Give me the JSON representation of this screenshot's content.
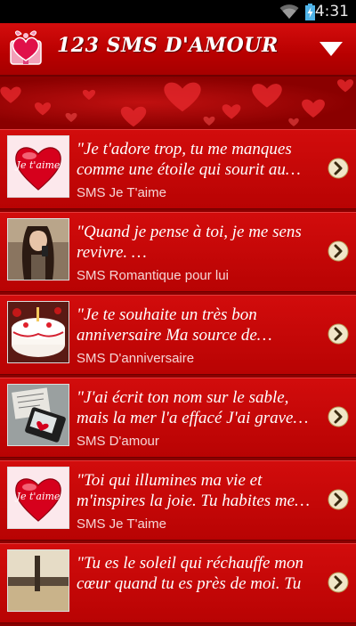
{
  "status_bar": {
    "time": "4:31",
    "icons": [
      "wifi-icon",
      "battery-charging-icon"
    ]
  },
  "app": {
    "title": "123 SMS D'AMOUR",
    "logo_icon": "heart-gift-box-icon",
    "menu_icon": "triangle-down-icon",
    "accent_color": "#c80000"
  },
  "items": [
    {
      "line1": "\"Je t'adore trop, tu me manques",
      "line2": "comme une étoile qui sourit au…",
      "category": "SMS Je T'aime",
      "thumb": "heart-jetaime",
      "thumb_text": "Je t'aime"
    },
    {
      "line1": "\"Quand je pense à toi, je me sens",
      "line2": "revivre.  …",
      "category": "SMS Romantique pour lui",
      "thumb": "woman-phone",
      "thumb_text": ""
    },
    {
      "line1": "\"Je te souhaite un très bon",
      "line2": "anniversaire Ma source de…",
      "category": "SMS D'anniversaire",
      "thumb": "birthday-cake",
      "thumb_text": ""
    },
    {
      "line1": "\"J'ai écrit ton nom sur le sable,",
      "line2": "mais la mer l'a effacé  J'ai grave…",
      "category": "SMS D'amour",
      "thumb": "phone-heart",
      "thumb_text": ""
    },
    {
      "line1": "\"Toi qui illumines ma vie et",
      "line2": "m'inspires la joie. Tu habites me…",
      "category": "SMS Je T'aime",
      "thumb": "heart-jetaime",
      "thumb_text": "Je t'aime"
    },
    {
      "line1": "\"Tu es le soleil qui réchauffe mon",
      "line2": "cœur quand tu es près de moi.  Tu",
      "category": "",
      "thumb": "sky-text",
      "thumb_text": ""
    }
  ]
}
